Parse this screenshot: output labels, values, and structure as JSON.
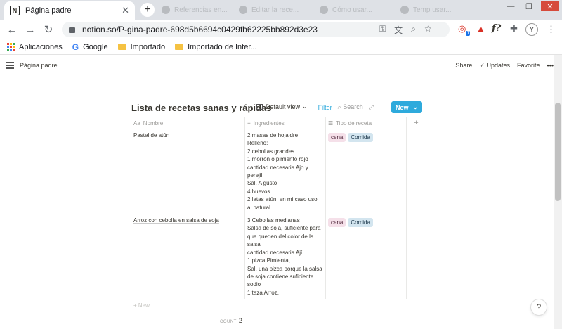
{
  "browser": {
    "tab_title": "Página padre",
    "tab_favicon": "N",
    "bg_tabs": [
      "Referencias en...",
      "Editar la rece...",
      "Cómo usar...",
      "Temp usar..."
    ],
    "url": "notion.so/P-gina-padre-698d5b6694c0429fb62225bb892d3e23",
    "avatar": "Y",
    "ext_badge": "1",
    "ext_fx": "f?"
  },
  "bookmarks": [
    {
      "label": "Aplicaciones",
      "icon": "apps-grid-icon"
    },
    {
      "label": "Google",
      "icon": "google-icon"
    },
    {
      "label": "Importado",
      "icon": "folder-icon"
    },
    {
      "label": "Importado de Inter...",
      "icon": "folder-icon"
    }
  ],
  "notion": {
    "breadcrumb": "Página padre",
    "actions": {
      "share": "Share",
      "updates": "Updates",
      "favorite": "Favorite",
      "more": "•••"
    }
  },
  "database": {
    "title": "Lista de recetas sanas y rápidas",
    "view": "Default view",
    "filter": "Filter",
    "search": "Search",
    "more": "···",
    "new": "New",
    "columns": [
      "Nombre",
      "Ingredientes",
      "Tipo de receta"
    ],
    "add_column": "+",
    "rows": [
      {
        "name": "Pastel de atún",
        "ingredients": [
          "2 masas de hojaldre",
          "Relleno:",
          "2 cebollas grandes",
          "1 morrón o pimiento rojo",
          "cantidad necesaria Ajo y",
          "perejil,",
          "Sal. A gusto",
          "4 huevos",
          "2 latas atún, en mi caso uso",
          "al natural"
        ],
        "tags": [
          "cena",
          "Comida"
        ]
      },
      {
        "name": "Arroz con cebolla en salsa de soja",
        "ingredients": [
          "3 Cebollas medianas",
          "Salsa de soja, suficiente para",
          "que queden del color de la",
          "salsa",
          "cantidad necesaria Ají,",
          "1 pizca Pimienta,",
          "Sal, una pizca porque la salsa",
          "de soja contiene suficiente",
          "sodio",
          "1 taza Arroz,"
        ],
        "tags": [
          "cena",
          "Comida"
        ]
      }
    ],
    "new_row": "+ New",
    "count_label": "COUNT",
    "count_value": "2"
  },
  "help": "?"
}
